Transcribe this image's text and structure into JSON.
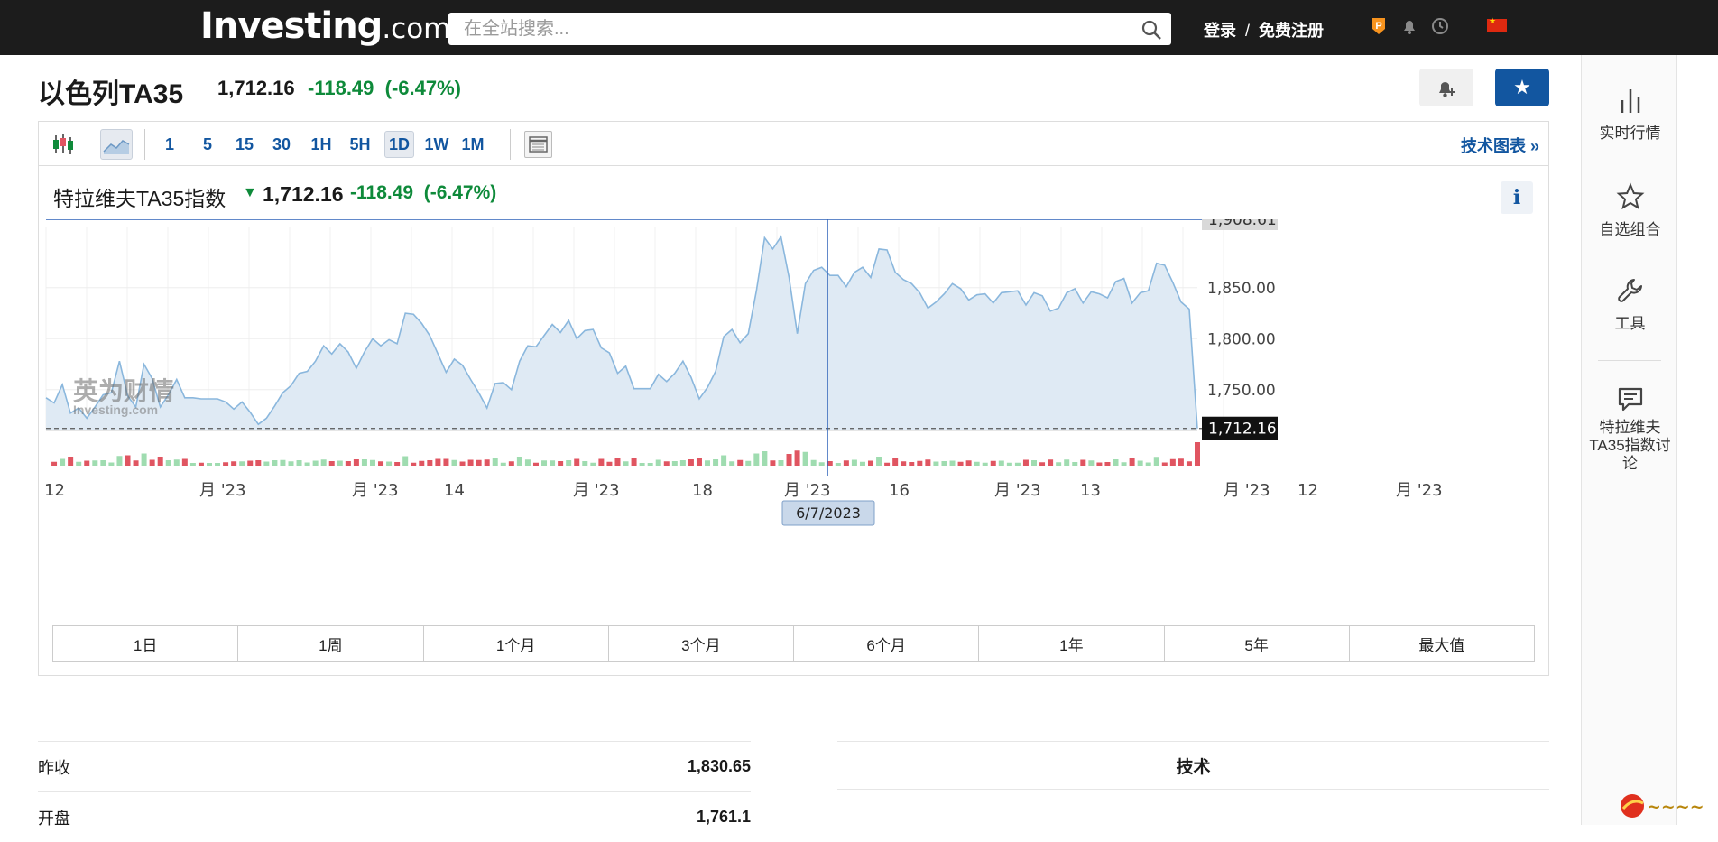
{
  "topbar": {
    "logo_main": "Investing",
    "logo_suffix": ".com",
    "search_placeholder": "在全站搜索...",
    "login": "登录",
    "separator": "/",
    "register": "免费注册"
  },
  "header": {
    "title": "以色列TA35",
    "price": "1,712.16",
    "change": "-118.49",
    "change_pct": "(-6.47%)"
  },
  "toolbar": {
    "intervals": [
      "1",
      "5",
      "15",
      "30",
      "1H",
      "5H",
      "1D",
      "1W",
      "1M"
    ],
    "active_interval": "1D",
    "tech_chart_link": "技术图表 »"
  },
  "chart_header": {
    "name": "特拉维夫TA35指数",
    "price": "1,712.16",
    "change": "-118.49",
    "change_pct": "(-6.47%)",
    "info": "i"
  },
  "chart_data": {
    "type": "area",
    "y_tick_labels": [
      "1,850.00",
      "1,800.00",
      "1,750.00"
    ],
    "ylim": [
      1710,
      1910
    ],
    "high_label": "1,908.61",
    "last_label": "1,712.16",
    "x_tick_labels": [
      "12",
      "月 '23",
      "月 '23",
      "14",
      "月 '23",
      "18",
      "月 '23",
      "16",
      "月 '23",
      "13",
      "月 '23",
      "12",
      "月 '23"
    ],
    "crosshair_date": "6/7/2023",
    "values": [
      1742,
      1737,
      1755,
      1727,
      1732,
      1722,
      1733,
      1745,
      1747,
      1778,
      1744,
      1733,
      1775,
      1761,
      1733,
      1745,
      1760,
      1742,
      1742,
      1741,
      1741,
      1741,
      1738,
      1731,
      1738,
      1728,
      1716,
      1722,
      1734,
      1747,
      1754,
      1766,
      1768,
      1778,
      1793,
      1785,
      1795,
      1787,
      1771,
      1787,
      1800,
      1793,
      1799,
      1795,
      1825,
      1824,
      1815,
      1803,
      1785,
      1767,
      1780,
      1774,
      1760,
      1747,
      1732,
      1756,
      1757,
      1750,
      1778,
      1793,
      1792,
      1803,
      1814,
      1806,
      1818,
      1800,
      1808,
      1809,
      1791,
      1786,
      1766,
      1773,
      1751,
      1751,
      1751,
      1765,
      1758,
      1766,
      1778,
      1762,
      1741,
      1752,
      1768,
      1802,
      1809,
      1796,
      1805,
      1847,
      1899,
      1888,
      1900,
      1860,
      1805,
      1854,
      1867,
      1870,
      1862,
      1862,
      1851,
      1865,
      1870,
      1860,
      1888,
      1887,
      1865,
      1858,
      1854,
      1845,
      1830,
      1836,
      1844,
      1854,
      1849,
      1838,
      1843,
      1844,
      1835,
      1845,
      1846,
      1847,
      1833,
      1845,
      1842,
      1827,
      1830,
      1845,
      1849,
      1835,
      1846,
      1844,
      1840,
      1856,
      1859,
      1835,
      1845,
      1847,
      1874,
      1872,
      1855,
      1836,
      1829,
      1712
    ],
    "volume_note": "volume bars (red/green) shown beneath price area"
  },
  "ranges": [
    "1日",
    "1周",
    "1个月",
    "3个月",
    "6个月",
    "1年",
    "5年",
    "最大值"
  ],
  "stats": [
    {
      "label": "昨收",
      "value": "1,830.65"
    },
    {
      "label": "开盘",
      "value": "1,761.1"
    }
  ],
  "technical_box": "技术",
  "rail": [
    {
      "label": "实时行情",
      "icon": "bar-chart-icon"
    },
    {
      "label": "自选组合",
      "icon": "star-outline-icon"
    },
    {
      "label": "工具",
      "icon": "wrench-icon"
    },
    {
      "label": "特拉维夫TA35指数讨论",
      "icon": "comment-icon"
    }
  ],
  "watermark": "英为财情 Investing.com",
  "colors": {
    "topbar": "#1c1c1c",
    "accent_blue": "#1256a0",
    "down_green": "#0e8a3a",
    "area_line": "#8ab7dd",
    "area_fill": "#dfeaf4",
    "vol_red": "#e05561",
    "vol_green": "#9fdcb0"
  }
}
